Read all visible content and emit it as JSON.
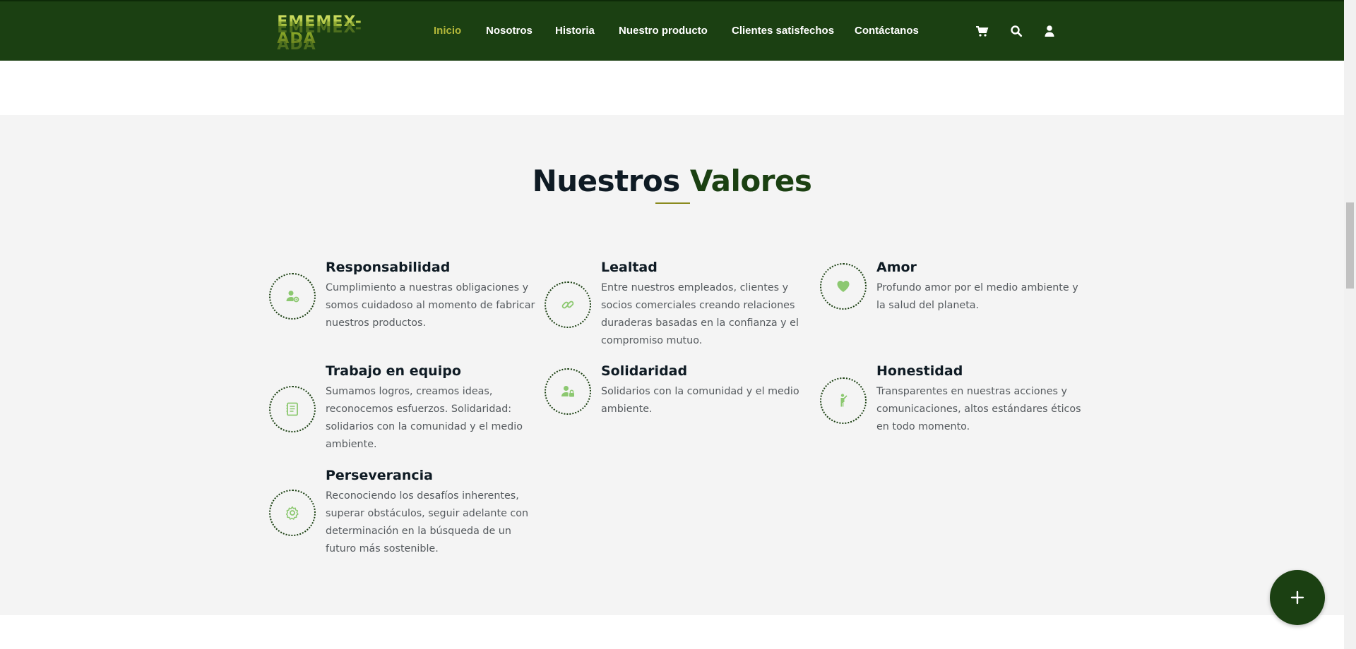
{
  "header": {
    "logo_text": "EMEMEX-ADA",
    "nav": [
      {
        "label": "Inicio",
        "active": true
      },
      {
        "label": "Nosotros"
      },
      {
        "label": "Historia"
      },
      {
        "label": "Nuestro producto"
      },
      {
        "label": "Clientes satisfechos"
      },
      {
        "label": "Contáctanos"
      }
    ],
    "icons": [
      "cart-icon",
      "search-icon",
      "user-icon"
    ]
  },
  "section": {
    "title_part1": "Nuestros",
    "title_part2": "Valores",
    "values": [
      {
        "title": "Responsabilidad",
        "text": "Cumplimiento a nuestras obligaciones y somos cuidadoso al momento de fabricar nuestros productos.",
        "icon": "user-gear-icon"
      },
      {
        "title": "Lealtad",
        "text": "Entre nuestros empleados, clientes y socios comerciales creando relaciones duraderas basadas en la confianza y el compromiso mutuo.",
        "icon": "link-icon"
      },
      {
        "title": "Amor",
        "text": "Profundo amor por el medio ambiente y la salud del planeta.",
        "icon": "heart-icon"
      },
      {
        "title": "Trabajo en equipo",
        "text": "Sumamos logros, creamos ideas, reconocemos esfuerzos. Solidaridad: solidarios con la comunidad y el medio ambiente.",
        "icon": "document-icon"
      },
      {
        "title": "Solidaridad",
        "text": "Solidarios con la comunidad y el medio ambiente.",
        "icon": "user-lock-icon"
      },
      {
        "title": "Honestidad",
        "text": "Transparentes en nuestras acciones y comunicaciones, altos estándares éticos en todo momento.",
        "icon": "person-icon"
      },
      {
        "title": "Perseverancia",
        "text": "Reconociendo los desafíos inherentes, superar obstáculos, seguir adelante con determinación en la búsqueda de un futuro más sostenible.",
        "icon": "gear-icon"
      }
    ]
  },
  "colors": {
    "header_bg": "#1b4012",
    "accent_green": "#1b4012",
    "nav_active": "#b4b83a",
    "icon_green": "#8cc870",
    "band_bg": "#f4f4f4"
  },
  "fab": {
    "icon": "plus-icon"
  }
}
